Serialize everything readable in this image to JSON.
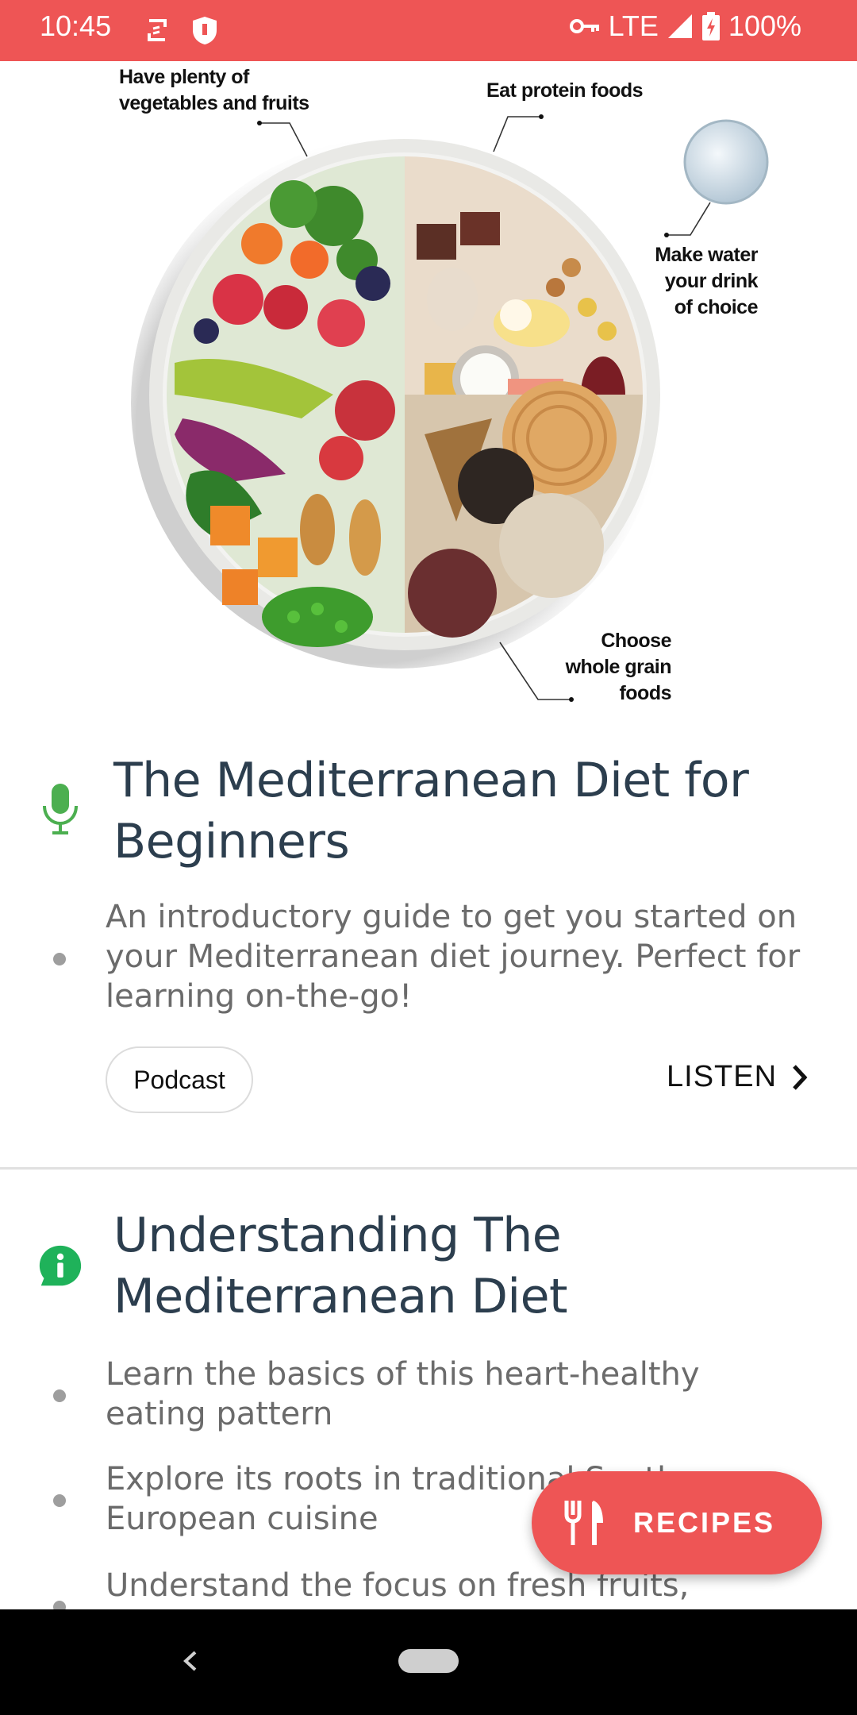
{
  "status_bar": {
    "time": "10:45",
    "network": "LTE",
    "battery": "100%",
    "icons": [
      "sync-icon",
      "shield-icon",
      "vpn-key-icon",
      "signal-icon",
      "battery-charging-icon"
    ]
  },
  "hero": {
    "labels": {
      "vegetables": [
        "Have plenty of",
        "vegetables and fruits"
      ],
      "protein": "Eat protein foods",
      "water": [
        "Make water",
        "your drink",
        "of choice"
      ],
      "grains": [
        "Choose",
        "whole grain",
        "foods"
      ]
    }
  },
  "cards": [
    {
      "icon": "microphone-icon",
      "icon_color": "#4caf50",
      "title": "The Mediterranean Diet for Beginners",
      "bullets": [
        "An introductory guide to get you started on your Mediterranean diet journey. Perfect for learning on-the-go!"
      ],
      "chip": "Podcast",
      "action": "LISTEN"
    },
    {
      "icon": "info-chat-icon",
      "icon_color": "#1fb25a",
      "title": "Understanding The Mediterranean Diet",
      "bullets": [
        "Learn the basics of this heart-healthy eating pattern",
        "Explore its roots in traditional Southern European cuisine",
        "Understand the focus on fresh fruits,"
      ]
    }
  ],
  "fab": {
    "label": "RECIPES",
    "icon": "fork-knife-icon"
  },
  "nav": {
    "icons": [
      "back-icon",
      "home-pill-icon"
    ]
  },
  "colors": {
    "accent": "#ee5555",
    "title": "#2c3e4e",
    "body": "#6b6b6b"
  }
}
